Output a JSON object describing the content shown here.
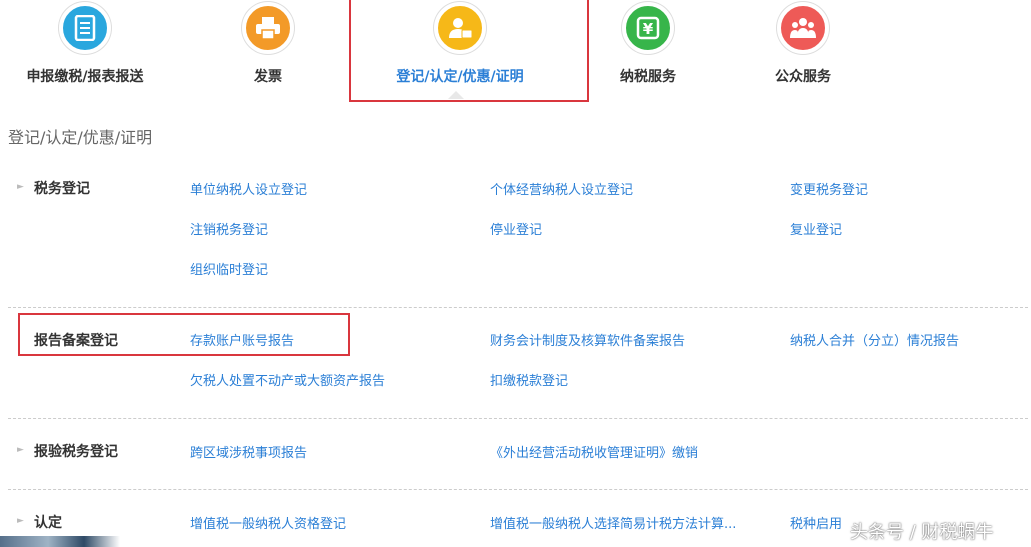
{
  "nav": {
    "items": [
      {
        "label": "申报缴税/报表报送",
        "icon": "document-icon",
        "color": "#2aa7de"
      },
      {
        "label": "发票",
        "icon": "printer-icon",
        "color": "#f39a28"
      },
      {
        "label": "登记/认定/优惠/证明",
        "icon": "user-badge-icon",
        "color": "#f6b818",
        "active": true
      },
      {
        "label": "纳税服务",
        "icon": "yen-icon",
        "color": "#37b54a"
      },
      {
        "label": "公众服务",
        "icon": "people-icon",
        "color": "#ee5a57"
      }
    ]
  },
  "section": {
    "title": "登记/认定/优惠/证明"
  },
  "categories": [
    {
      "label": "税务登记",
      "links": [
        "单位纳税人设立登记",
        "个体经营纳税人设立登记",
        "变更税务登记",
        "注销税务登记",
        "停业登记",
        "复业登记",
        "组织临时登记"
      ]
    },
    {
      "label": "报告备案登记",
      "links": [
        "存款账户账号报告",
        "财务会计制度及核算软件备案报告",
        "纳税人合并（分立）情况报告",
        "欠税人处置不动产或大额资产报告",
        "扣缴税款登记"
      ]
    },
    {
      "label": "报验税务登记",
      "links": [
        "跨区域涉税事项报告",
        "《外出经营活动税收管理证明》缴销"
      ]
    },
    {
      "label": "认定",
      "links": [
        "增值税一般纳税人资格登记",
        "增值税一般纳税人选择简易计税方法计算...",
        "税种启用"
      ]
    }
  ],
  "watermark": "头条号 / 财税蜗牛",
  "colors": {
    "link": "#2b7fd6",
    "highlight": "#d9363e"
  }
}
